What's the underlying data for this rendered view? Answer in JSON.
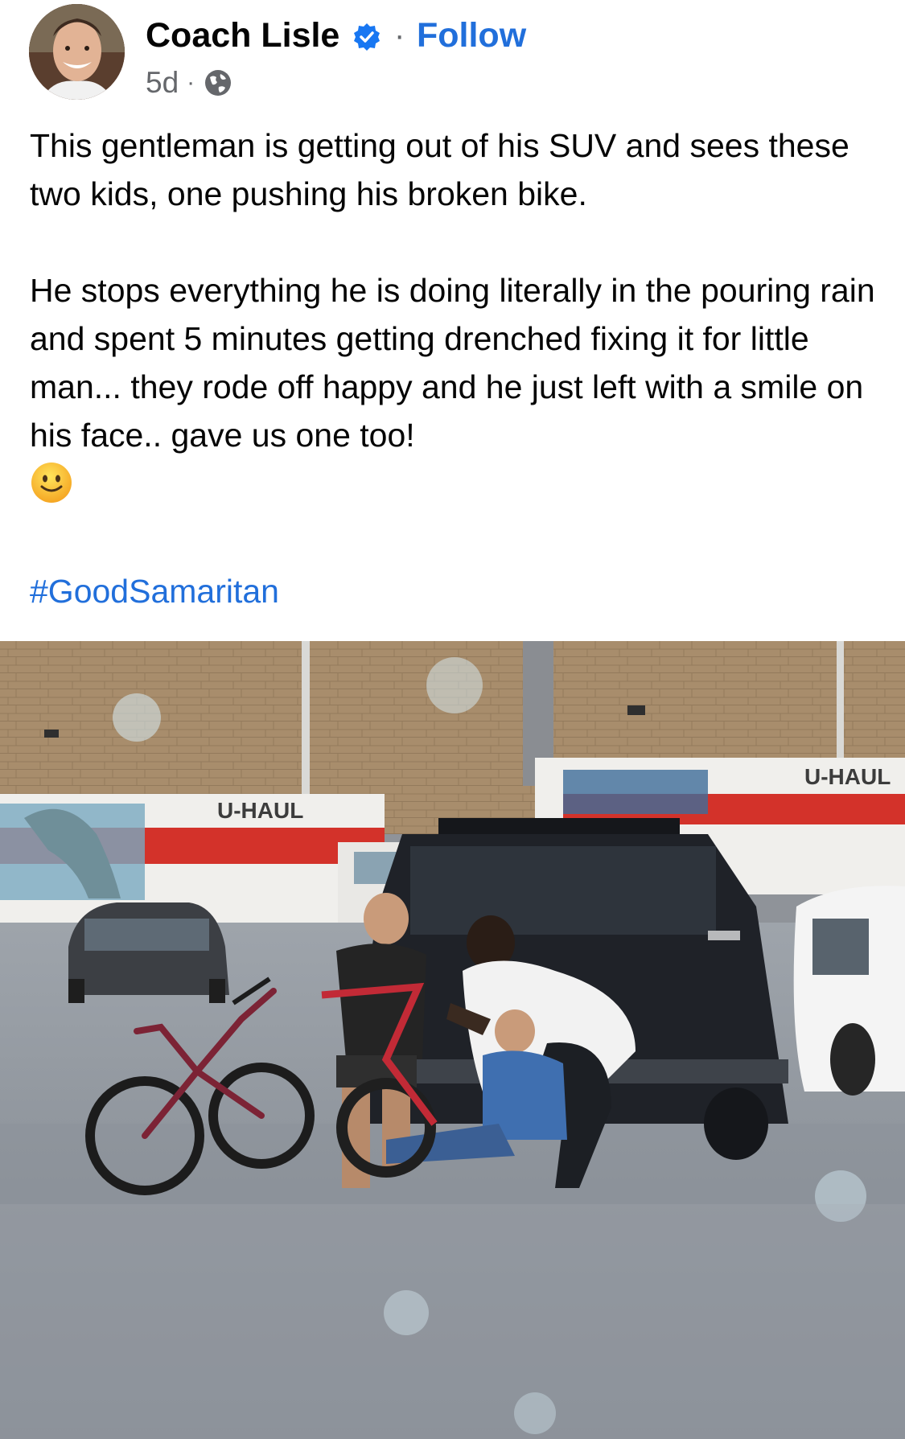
{
  "post": {
    "author_name": "Coach Lisle",
    "follow_separator": "·",
    "follow_label": "Follow",
    "timestamp": "5d",
    "meta_separator": "·",
    "paragraph_1": "This gentleman is getting out of his SUV and sees these two kids, one pushing his broken bike.",
    "paragraph_2": "He stops everything he is doing literally in the pouring rain and spent 5 minutes getting drenched fixing it for little man... they rode off happy and he just left with a smile on his face.. gave us one too!",
    "hashtag": "#GoodSamaritan",
    "audience_icon": "globe-icon",
    "verified_icon": "verified-badge-icon",
    "emoji": "slightly-smiling-face-emoji"
  },
  "photo": {
    "sign_left": "U-HAUL",
    "sign_right": "U-HAUL"
  },
  "colors": {
    "link_blue": "#216fdb",
    "text": "#050505",
    "meta_gray": "#65676b",
    "uhaul_orange": "#d3322a"
  }
}
